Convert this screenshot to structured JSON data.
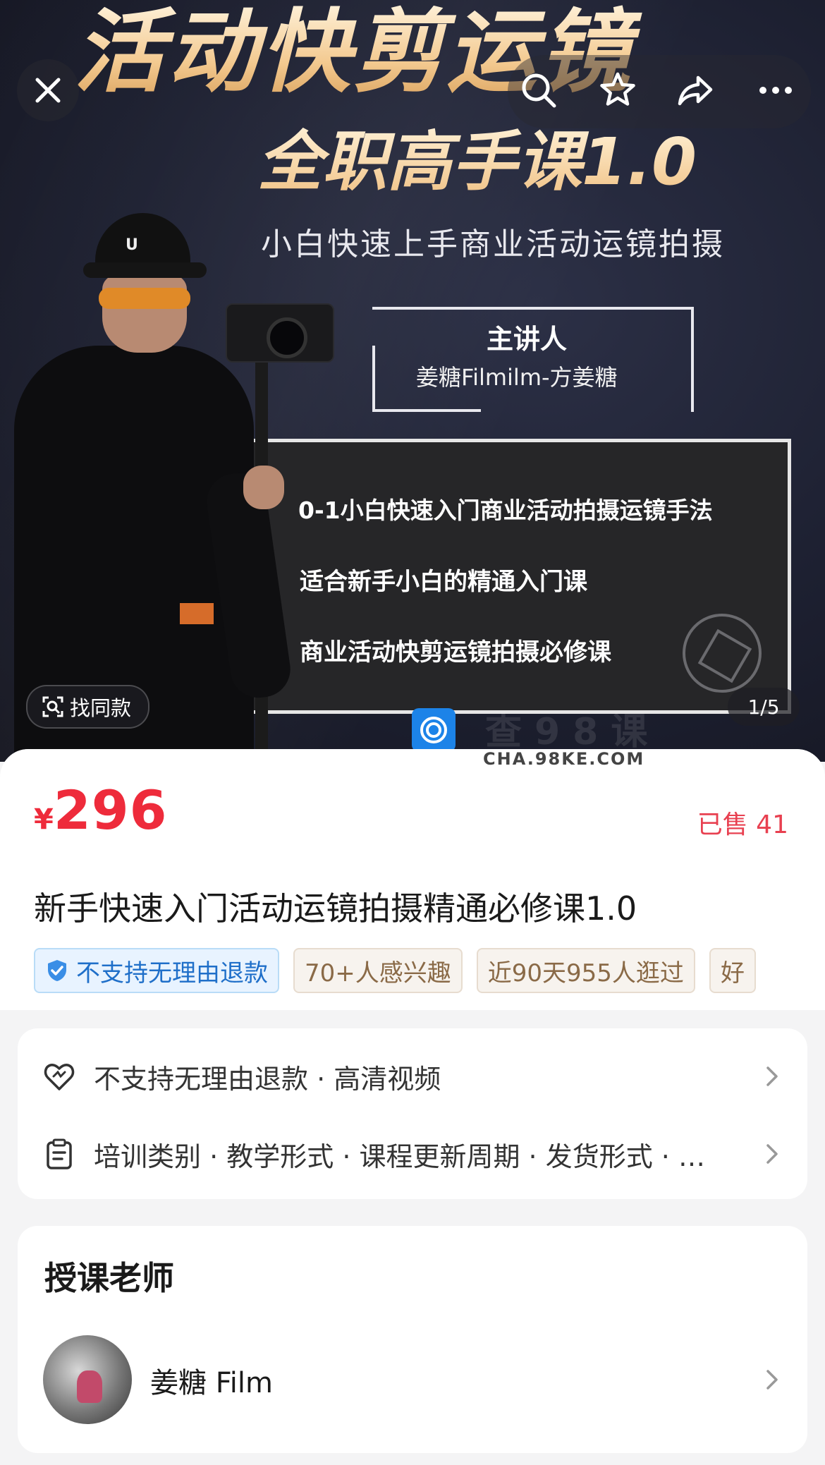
{
  "hero": {
    "poster_title": "活动快剪运镜",
    "poster_subtitle": "全职高手课1.0",
    "poster_tagline": "小白快速上手商业活动运镜拍摄",
    "speaker_label": "主讲人",
    "speaker_name": "姜糖Filmilm-方姜糖",
    "points": [
      "0-1小白快速入门商业活动拍摄运镜手法",
      "适合新手小白的精通入门课",
      "商业活动快剪运镜拍摄必修课"
    ],
    "cap_logo": "U",
    "find_similar_label": "找同款",
    "pager": "1/5",
    "watermark_url": "CHA.98KE.COM",
    "watermark_cn": "查98课"
  },
  "icons": {
    "close": "close-icon",
    "search": "search-icon",
    "favorite": "star-icon",
    "share": "share-icon",
    "more": "more-icon"
  },
  "product": {
    "currency": "¥",
    "price": "296",
    "sold": "已售 41",
    "title": "新手快速入门活动运镜拍摄精通必修课1.0",
    "tags": [
      {
        "label": "不支持无理由退款"
      },
      {
        "label": "70+人感兴趣"
      },
      {
        "label": "近90天955人逛过"
      },
      {
        "label": "好"
      }
    ]
  },
  "info_rows": [
    {
      "text": "不支持无理由退款 · 高清视频"
    },
    {
      "text": "培训类别 · 教学形式 · 课程更新周期 · 发货形式 · …"
    }
  ],
  "teacher": {
    "section_title": "授课老师",
    "name": "姜糖 Film"
  },
  "colors": {
    "price_red": "#ee2b3b",
    "tag_blue": "#1f6fc9",
    "tag_warm": "#8a6a47",
    "poster_gold": "#f3c98f",
    "watermark_blue": "#1c83e8"
  }
}
